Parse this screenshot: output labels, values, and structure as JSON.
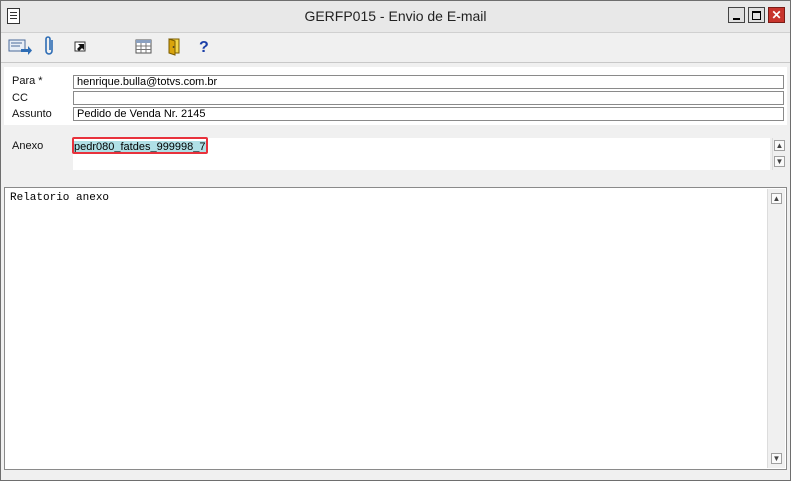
{
  "window": {
    "title": "GERFP015 - Envio de E-mail",
    "controls": {
      "minimize": "minimize",
      "maximize": "maximize",
      "close": "✕"
    }
  },
  "toolbar": {
    "items": [
      {
        "icon": "send-email-icon"
      },
      {
        "icon": "paperclip-icon"
      },
      {
        "icon": "cursor-arrow-icon"
      },
      {
        "icon": "calendar-grid-icon"
      },
      {
        "icon": "exit-door-icon"
      },
      {
        "icon": "help-question-icon"
      }
    ]
  },
  "form": {
    "to_label": "Para *",
    "to_value": "henrique.bulla@totvs.com.br",
    "cc_label": "CC",
    "cc_value": "",
    "subject_label": "Assunto",
    "subject_value": "Pedido de Venda Nr. 2145",
    "attachment_label": "Anexo",
    "attachment_value": "pedr080_fatdes_999998_7("
  },
  "body": {
    "text": "Relatorio anexo"
  },
  "colors": {
    "attachment_selection": "#b0e0e6",
    "highlight_border": "#e8323c",
    "close_button": "#c8342c"
  }
}
